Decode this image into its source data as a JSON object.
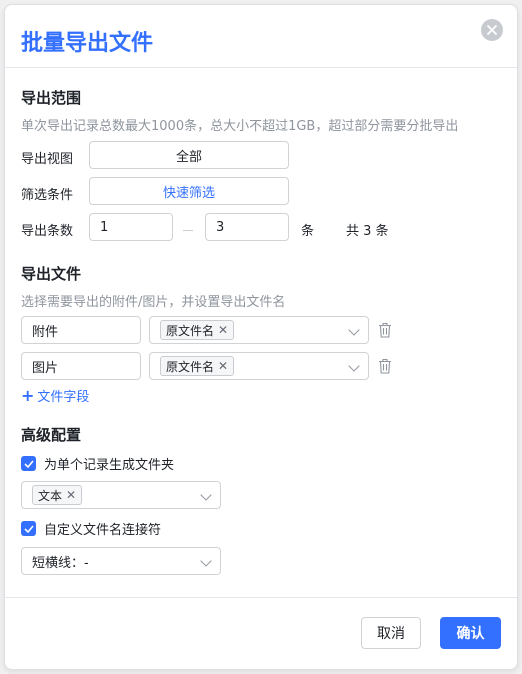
{
  "dialog": {
    "title": "批量导出文件"
  },
  "range": {
    "title": "导出范围",
    "hint": "单次导出记录总数最大1000条，总大小不超过1GB，超过部分需要分批导出",
    "view_label": "导出视图",
    "view_value": "全部",
    "filter_label": "筛选条件",
    "filter_value": "快速筛选",
    "count_label": "导出条数",
    "from": "1",
    "to": "3",
    "unit": "条",
    "total": "共 3 条"
  },
  "files": {
    "title": "导出文件",
    "hint": "选择需要导出的附件/图片，并设置导出文件名",
    "rows": [
      {
        "field": "附件",
        "tag": "原文件名"
      },
      {
        "field": "图片",
        "tag": "原文件名"
      }
    ],
    "add_label": "文件字段"
  },
  "advanced": {
    "title": "高级配置",
    "folder_checkbox": "为单个记录生成文件夹",
    "folder_checked": true,
    "folder_tag": "文本",
    "joiner_checkbox": "自定义文件名连接符",
    "joiner_checked": true,
    "joiner_value": "短横线：-"
  },
  "footer": {
    "cancel": "取消",
    "confirm": "确认"
  },
  "colors": {
    "accent": "#3370ff",
    "border": "#d0d3d6",
    "hint": "#8f959e"
  },
  "icons": {
    "close": "close-icon",
    "trash": "trash-icon",
    "chevron": "chevron-down-icon",
    "check": "check-icon",
    "plus": "plus-icon"
  }
}
